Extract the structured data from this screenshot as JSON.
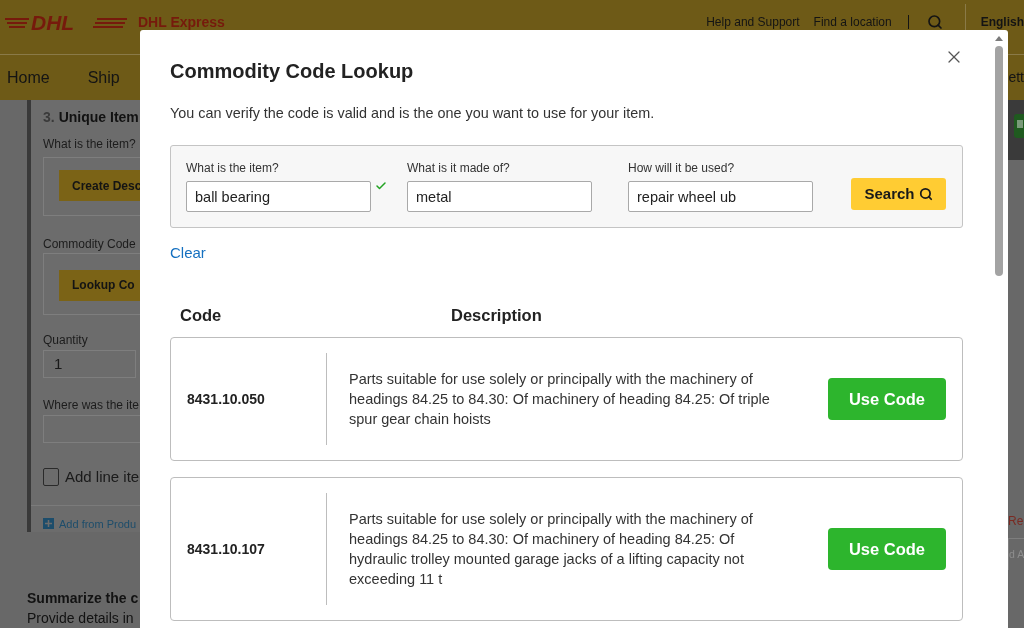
{
  "header": {
    "logo_text": "DHL",
    "brand": "DHL Express",
    "links": [
      "Help and Support",
      "Find a location"
    ],
    "language": "English"
  },
  "nav": {
    "items": [
      "Home",
      "Ship"
    ],
    "cut_item": "ett"
  },
  "background_form": {
    "section_number": "3.",
    "section_title": "Unique Item",
    "item_label": "What is the item?",
    "describe_button": "Create Desc",
    "code_label": "Commodity Code",
    "lookup_button": "Lookup Co",
    "quantity_label": "Quantity",
    "quantity_value": "1",
    "origin_label": "Where was the ite",
    "add_line": {
      "label": "Add line ite",
      "checked": false
    },
    "add_from_link": "Add from Produ"
  },
  "summary": {
    "title": "Summarize the c",
    "text": "Provide details in"
  },
  "side_edge": {
    "link": "Re",
    "button": "d A"
  },
  "modal": {
    "title": "Commodity Code Lookup",
    "subtitle": "You can verify the code is valid and is the one you want to use for your item.",
    "fields": [
      {
        "label": "What is the item?",
        "value": "ball bearing",
        "valid": true
      },
      {
        "label": "What is it made of?",
        "value": "metal",
        "valid": false
      },
      {
        "label": "How will it be used?",
        "value": "repair wheel ub",
        "valid": false
      }
    ],
    "search_button": "Search",
    "clear_link": "Clear",
    "columns": [
      "Code",
      "Description"
    ],
    "results": [
      {
        "code": "8431.10.050",
        "description": "Parts suitable for use solely or principally with the machinery of headings 84.25 to 84.30: Of machinery of heading 84.25: Of triple spur gear chain hoists",
        "button": "Use Code"
      },
      {
        "code": "8431.10.107",
        "description": "Parts suitable for use solely or principally with the machinery of headings 84.25 to 84.30: Of machinery of heading 84.25: Of hydraulic trolley mounted garage jacks of a lifting capacity not exceeding 11 t",
        "button": "Use Code"
      }
    ]
  }
}
